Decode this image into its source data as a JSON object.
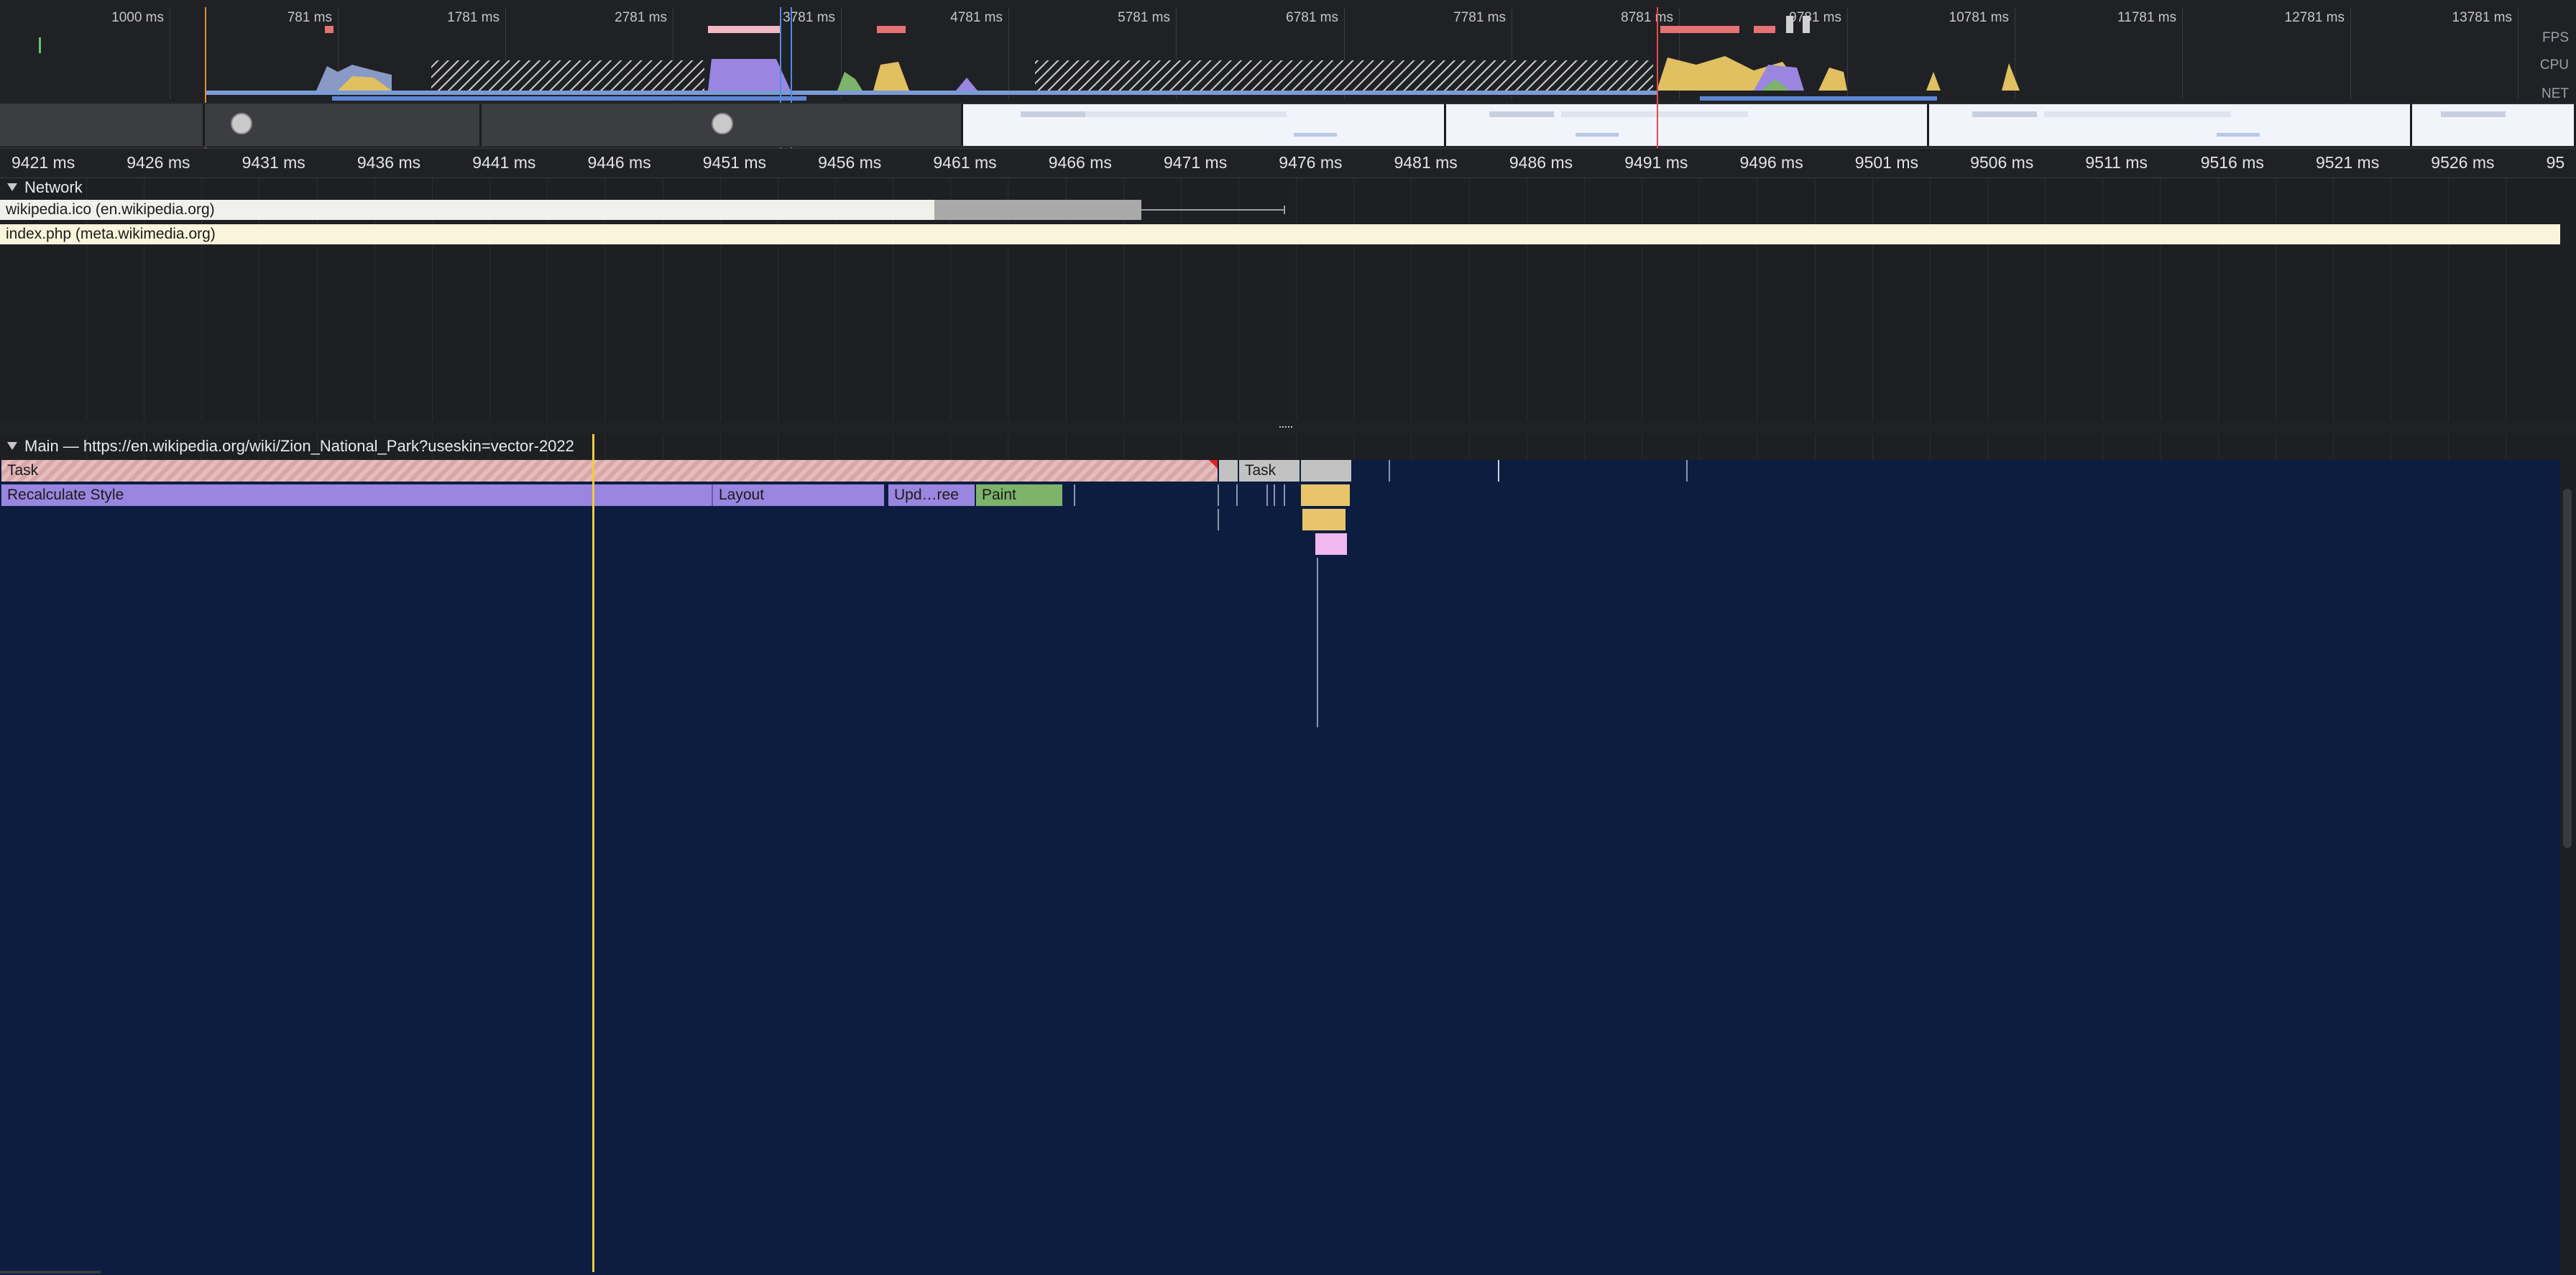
{
  "overview": {
    "ticks": [
      "1000 ms",
      "781 ms",
      "1781 ms",
      "2781 ms",
      "3781 ms",
      "4781 ms",
      "5781 ms",
      "6781 ms",
      "7781 ms",
      "8781 ms",
      "9781 ms",
      "10781 ms",
      "11781 ms",
      "12781 ms",
      "13781 ms"
    ],
    "tracks": {
      "fps": "FPS",
      "cpu": "CPU",
      "net": "NET"
    }
  },
  "ruler": {
    "ticks": [
      "9421 ms",
      "9426 ms",
      "9431 ms",
      "9436 ms",
      "9441 ms",
      "9446 ms",
      "9451 ms",
      "9456 ms",
      "9461 ms",
      "9466 ms",
      "9471 ms",
      "9476 ms",
      "9481 ms",
      "9486 ms",
      "9491 ms",
      "9496 ms",
      "9501 ms",
      "9506 ms",
      "9511 ms",
      "9516 ms",
      "9521 ms",
      "9526 ms",
      "95"
    ]
  },
  "network": {
    "title": "Network",
    "requests": [
      {
        "label": "wikipedia.ico (en.wikipedia.org)"
      },
      {
        "label": "index.php (meta.wikimedia.org)"
      }
    ]
  },
  "main": {
    "title": "Main — https://en.wikipedia.org/wiki/Zion_National_Park?useskin=vector-2022",
    "tasks": [
      "Task",
      "Task"
    ],
    "events": [
      "Recalculate Style",
      "Layout",
      "Upd…ree",
      "Paint"
    ]
  },
  "colors": {
    "style": "#9a86e0",
    "layout": "#9a86e0",
    "paint": "#7db36b",
    "script": "#e9c46a",
    "task": "#d9a3a3",
    "selection": "#f3c93d",
    "selected_bg": "#0c1d40"
  },
  "icons": [
    "collapse-triangle-icon"
  ]
}
